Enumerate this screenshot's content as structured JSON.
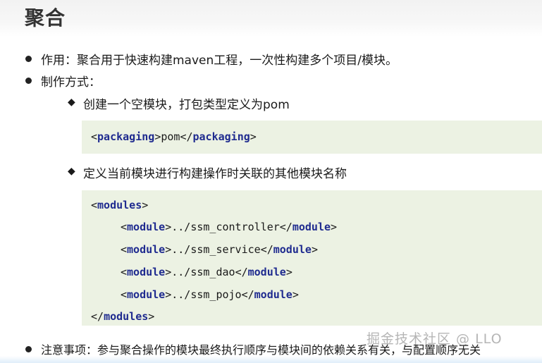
{
  "title": "聚合",
  "bullets": {
    "b1": "作用：聚合用于快速构建maven工程，一次性构建多个项目/模块。",
    "b2": "制作方式：",
    "b3": "注意事项：参与聚合操作的模块最终执行顺序与模块间的依赖关系有关，与配置顺序无关"
  },
  "sub": {
    "s1": "创建一个空模块，打包类型定义为pom",
    "s2": "定义当前模块进行构建操作时关联的其他模块名称"
  },
  "code1": {
    "open_lt": "<",
    "tag": "packaging",
    "open_gt": ">",
    "value": "pom",
    "close_lt": "</",
    "close_gt": ">"
  },
  "code2": {
    "outer_tag": "modules",
    "inner_tag": "module",
    "modules": [
      "../ssm_controller",
      "../ssm_service",
      "../ssm_dao",
      "../ssm_pojo"
    ]
  },
  "watermark": "掘金技术社区 @ LLO"
}
